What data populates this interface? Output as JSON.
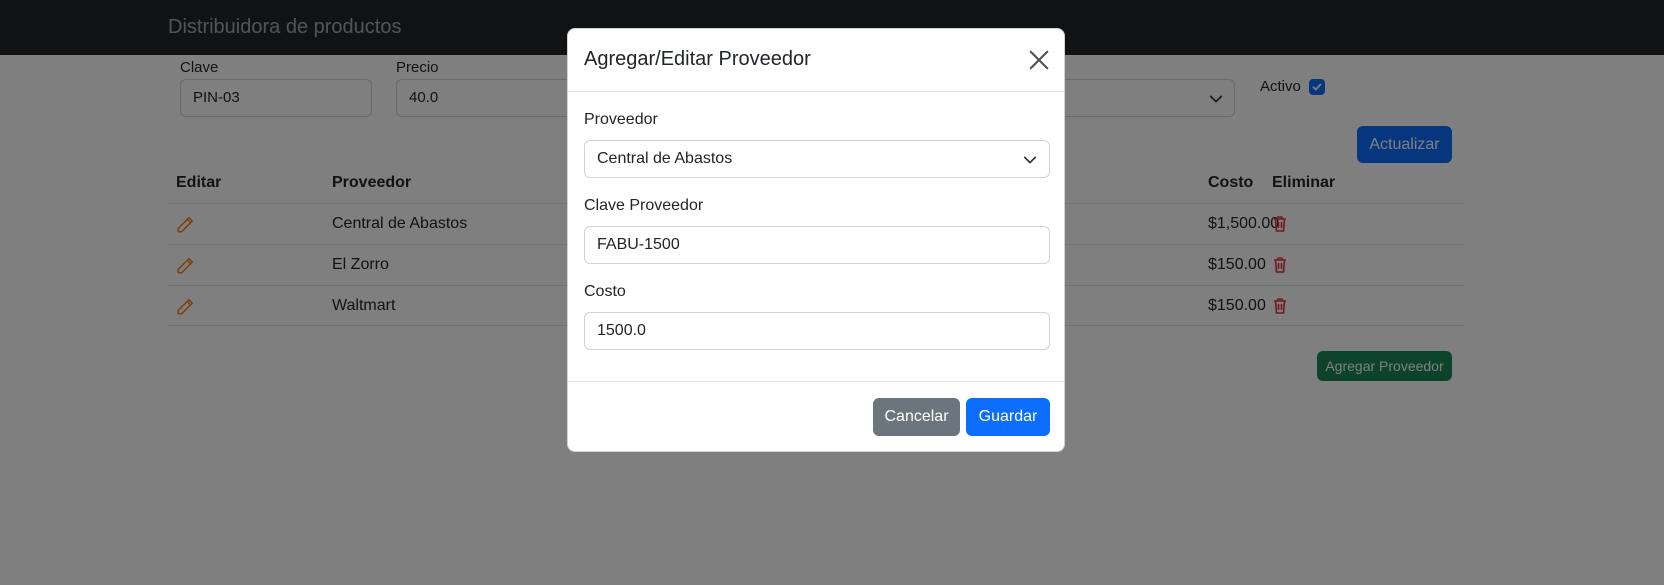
{
  "app": {
    "brand": "Distribuidora de productos"
  },
  "product_form": {
    "clave_label": "Clave",
    "clave_value": "PIN-03",
    "precio_label": "Precio",
    "precio_value": "40.0",
    "activo_label": "Activo",
    "activo_checked": true,
    "update_button": "Actualizar"
  },
  "table": {
    "headers": {
      "editar": "Editar",
      "proveedor": "Proveedor",
      "costo": "Costo",
      "eliminar": "Eliminar"
    },
    "rows": [
      {
        "proveedor": "Central de Abastos",
        "costo": "$1,500.00"
      },
      {
        "proveedor": "El Zorro",
        "costo": "$150.00"
      },
      {
        "proveedor": "Waltmart",
        "costo": "$150.00"
      }
    ]
  },
  "add_supplier_button": "Agregar Proveedor",
  "modal": {
    "title": "Agregar/Editar Proveedor",
    "proveedor_label": "Proveedor",
    "proveedor_selected": "Central de Abastos",
    "clave_label": "Clave Proveedor",
    "clave_value": "FABU-1500",
    "costo_label": "Costo",
    "costo_value": "1500.0",
    "cancel_button": "Cancelar",
    "save_button": "Guardar"
  },
  "colors": {
    "edit_icon": "#fd7e14",
    "delete_icon": "#dc3545",
    "primary": "#0d6efd",
    "success": "#198754",
    "secondary": "#6c757d",
    "navbar": "#212529"
  }
}
